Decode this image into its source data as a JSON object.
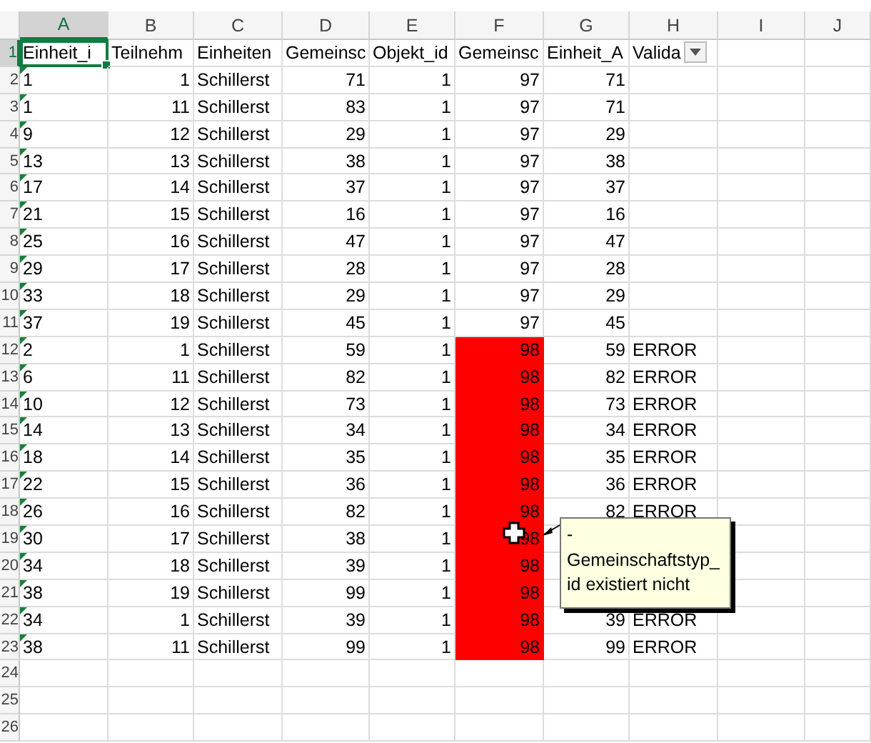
{
  "columns": [
    {
      "letter": "A",
      "selected": true
    },
    {
      "letter": "B",
      "selected": false
    },
    {
      "letter": "C",
      "selected": false
    },
    {
      "letter": "D",
      "selected": false
    },
    {
      "letter": "E",
      "selected": false
    },
    {
      "letter": "F",
      "selected": false
    },
    {
      "letter": "G",
      "selected": false
    },
    {
      "letter": "H",
      "selected": false
    },
    {
      "letter": "I",
      "selected": false
    },
    {
      "letter": "J",
      "selected": false
    }
  ],
  "rows": [
    {
      "row_number": "1",
      "selected": true,
      "cells": [
        {
          "kind": "text",
          "text": "Einheit_i"
        },
        {
          "kind": "text",
          "text": "Teilnehm"
        },
        {
          "kind": "text",
          "text": "Einheiten"
        },
        {
          "kind": "text",
          "text": "Gemeinsc"
        },
        {
          "kind": "text",
          "text": "Objekt_id"
        },
        {
          "kind": "text",
          "text": "Gemeinsc"
        },
        {
          "kind": "text",
          "text": "Einheit_A"
        },
        {
          "kind": "filter_header",
          "text": "Valida"
        }
      ]
    },
    {
      "row_number": "2",
      "selected": false,
      "cells": [
        {
          "kind": "text_number",
          "text": "1"
        },
        {
          "kind": "number",
          "text": "1"
        },
        {
          "kind": "text",
          "text": "Schillerst"
        },
        {
          "kind": "number",
          "text": "71"
        },
        {
          "kind": "number",
          "text": "1"
        },
        {
          "kind": "number",
          "text": "97"
        },
        {
          "kind": "number",
          "text": "71"
        }
      ]
    },
    {
      "row_number": "3",
      "selected": false,
      "cells": [
        {
          "kind": "text_number",
          "text": "1"
        },
        {
          "kind": "number",
          "text": "11"
        },
        {
          "kind": "text",
          "text": "Schillerst"
        },
        {
          "kind": "number",
          "text": "83"
        },
        {
          "kind": "number",
          "text": "1"
        },
        {
          "kind": "number",
          "text": "97"
        },
        {
          "kind": "number",
          "text": "71"
        }
      ]
    },
    {
      "row_number": "4",
      "selected": false,
      "cells": [
        {
          "kind": "text_number",
          "text": "9"
        },
        {
          "kind": "number",
          "text": "12"
        },
        {
          "kind": "text",
          "text": "Schillerst"
        },
        {
          "kind": "number",
          "text": "29"
        },
        {
          "kind": "number",
          "text": "1"
        },
        {
          "kind": "number",
          "text": "97"
        },
        {
          "kind": "number",
          "text": "29"
        }
      ]
    },
    {
      "row_number": "5",
      "selected": false,
      "cells": [
        {
          "kind": "text_number",
          "text": "13"
        },
        {
          "kind": "number",
          "text": "13"
        },
        {
          "kind": "text",
          "text": "Schillerst"
        },
        {
          "kind": "number",
          "text": "38"
        },
        {
          "kind": "number",
          "text": "1"
        },
        {
          "kind": "number",
          "text": "97"
        },
        {
          "kind": "number",
          "text": "38"
        }
      ]
    },
    {
      "row_number": "6",
      "selected": false,
      "cells": [
        {
          "kind": "text_number",
          "text": "17"
        },
        {
          "kind": "number",
          "text": "14"
        },
        {
          "kind": "text",
          "text": "Schillerst"
        },
        {
          "kind": "number",
          "text": "37"
        },
        {
          "kind": "number",
          "text": "1"
        },
        {
          "kind": "number",
          "text": "97"
        },
        {
          "kind": "number",
          "text": "37"
        }
      ]
    },
    {
      "row_number": "7",
      "selected": false,
      "cells": [
        {
          "kind": "text_number",
          "text": "21"
        },
        {
          "kind": "number",
          "text": "15"
        },
        {
          "kind": "text",
          "text": "Schillerst"
        },
        {
          "kind": "number",
          "text": "16"
        },
        {
          "kind": "number",
          "text": "1"
        },
        {
          "kind": "number",
          "text": "97"
        },
        {
          "kind": "number",
          "text": "16"
        }
      ]
    },
    {
      "row_number": "8",
      "selected": false,
      "cells": [
        {
          "kind": "text_number",
          "text": "25"
        },
        {
          "kind": "number",
          "text": "16"
        },
        {
          "kind": "text",
          "text": "Schillerst"
        },
        {
          "kind": "number",
          "text": "47"
        },
        {
          "kind": "number",
          "text": "1"
        },
        {
          "kind": "number",
          "text": "97"
        },
        {
          "kind": "number",
          "text": "47"
        }
      ]
    },
    {
      "row_number": "9",
      "selected": false,
      "cells": [
        {
          "kind": "text_number",
          "text": "29"
        },
        {
          "kind": "number",
          "text": "17"
        },
        {
          "kind": "text",
          "text": "Schillerst"
        },
        {
          "kind": "number",
          "text": "28"
        },
        {
          "kind": "number",
          "text": "1"
        },
        {
          "kind": "number",
          "text": "97"
        },
        {
          "kind": "number",
          "text": "28"
        }
      ]
    },
    {
      "row_number": "10",
      "selected": false,
      "cells": [
        {
          "kind": "text_number",
          "text": "33"
        },
        {
          "kind": "number",
          "text": "18"
        },
        {
          "kind": "text",
          "text": "Schillerst"
        },
        {
          "kind": "number",
          "text": "29"
        },
        {
          "kind": "number",
          "text": "1"
        },
        {
          "kind": "number",
          "text": "97"
        },
        {
          "kind": "number",
          "text": "29"
        }
      ]
    },
    {
      "row_number": "11",
      "selected": false,
      "cells": [
        {
          "kind": "text_number",
          "text": "37"
        },
        {
          "kind": "number",
          "text": "19"
        },
        {
          "kind": "text",
          "text": "Schillerst"
        },
        {
          "kind": "number",
          "text": "45"
        },
        {
          "kind": "number",
          "text": "1"
        },
        {
          "kind": "number",
          "text": "97"
        },
        {
          "kind": "number",
          "text": "45"
        }
      ]
    },
    {
      "row_number": "12",
      "selected": false,
      "cells": [
        {
          "kind": "text_number",
          "text": "2"
        },
        {
          "kind": "number",
          "text": "1"
        },
        {
          "kind": "text",
          "text": "Schillerst"
        },
        {
          "kind": "number",
          "text": "59"
        },
        {
          "kind": "number",
          "text": "1"
        },
        {
          "kind": "flagged_number",
          "text": "98"
        },
        {
          "kind": "number",
          "text": "59"
        },
        {
          "kind": "text",
          "text": "ERROR"
        }
      ]
    },
    {
      "row_number": "13",
      "selected": false,
      "cells": [
        {
          "kind": "text_number",
          "text": "6"
        },
        {
          "kind": "number",
          "text": "11"
        },
        {
          "kind": "text",
          "text": "Schillerst"
        },
        {
          "kind": "number",
          "text": "82"
        },
        {
          "kind": "number",
          "text": "1"
        },
        {
          "kind": "flagged_number",
          "text": "98"
        },
        {
          "kind": "number",
          "text": "82"
        },
        {
          "kind": "text",
          "text": "ERROR"
        }
      ]
    },
    {
      "row_number": "14",
      "selected": false,
      "cells": [
        {
          "kind": "text_number",
          "text": "10"
        },
        {
          "kind": "number",
          "text": "12"
        },
        {
          "kind": "text",
          "text": "Schillerst"
        },
        {
          "kind": "number",
          "text": "73"
        },
        {
          "kind": "number",
          "text": "1"
        },
        {
          "kind": "flagged_number",
          "text": "98"
        },
        {
          "kind": "number",
          "text": "73"
        },
        {
          "kind": "text",
          "text": "ERROR"
        }
      ]
    },
    {
      "row_number": "15",
      "selected": false,
      "cells": [
        {
          "kind": "text_number",
          "text": "14"
        },
        {
          "kind": "number",
          "text": "13"
        },
        {
          "kind": "text",
          "text": "Schillerst"
        },
        {
          "kind": "number",
          "text": "34"
        },
        {
          "kind": "number",
          "text": "1"
        },
        {
          "kind": "flagged_number",
          "text": "98"
        },
        {
          "kind": "number",
          "text": "34"
        },
        {
          "kind": "text",
          "text": "ERROR"
        }
      ]
    },
    {
      "row_number": "16",
      "selected": false,
      "cells": [
        {
          "kind": "text_number",
          "text": "18"
        },
        {
          "kind": "number",
          "text": "14"
        },
        {
          "kind": "text",
          "text": "Schillerst"
        },
        {
          "kind": "number",
          "text": "35"
        },
        {
          "kind": "number",
          "text": "1"
        },
        {
          "kind": "flagged_number",
          "text": "98"
        },
        {
          "kind": "number",
          "text": "35"
        },
        {
          "kind": "text",
          "text": "ERROR"
        }
      ]
    },
    {
      "row_number": "17",
      "selected": false,
      "cells": [
        {
          "kind": "text_number",
          "text": "22"
        },
        {
          "kind": "number",
          "text": "15"
        },
        {
          "kind": "text",
          "text": "Schillerst"
        },
        {
          "kind": "number",
          "text": "36"
        },
        {
          "kind": "number",
          "text": "1"
        },
        {
          "kind": "flagged_number",
          "text": "98"
        },
        {
          "kind": "number",
          "text": "36"
        },
        {
          "kind": "text",
          "text": "ERROR"
        }
      ]
    },
    {
      "row_number": "18",
      "selected": false,
      "cells": [
        {
          "kind": "text_number",
          "text": "26"
        },
        {
          "kind": "number",
          "text": "16"
        },
        {
          "kind": "text",
          "text": "Schillerst"
        },
        {
          "kind": "number",
          "text": "82"
        },
        {
          "kind": "number",
          "text": "1"
        },
        {
          "kind": "flagged_number",
          "text": "98"
        },
        {
          "kind": "number",
          "text": "82"
        },
        {
          "kind": "text",
          "text": "ERROR"
        }
      ]
    },
    {
      "row_number": "19",
      "selected": false,
      "cells": [
        {
          "kind": "text_number",
          "text": "30"
        },
        {
          "kind": "number",
          "text": "17"
        },
        {
          "kind": "text",
          "text": "Schillerst"
        },
        {
          "kind": "number",
          "text": "38"
        },
        {
          "kind": "number",
          "text": "1"
        },
        {
          "kind": "flagged_number",
          "text": "98"
        }
      ]
    },
    {
      "row_number": "20",
      "selected": false,
      "cells": [
        {
          "kind": "text_number",
          "text": "34"
        },
        {
          "kind": "number",
          "text": "18"
        },
        {
          "kind": "text",
          "text": "Schillerst"
        },
        {
          "kind": "number",
          "text": "39"
        },
        {
          "kind": "number",
          "text": "1"
        },
        {
          "kind": "flagged_number",
          "text": "98"
        }
      ]
    },
    {
      "row_number": "21",
      "selected": false,
      "cells": [
        {
          "kind": "text_number",
          "text": "38"
        },
        {
          "kind": "number",
          "text": "19"
        },
        {
          "kind": "text",
          "text": "Schillerst"
        },
        {
          "kind": "number",
          "text": "99"
        },
        {
          "kind": "number",
          "text": "1"
        },
        {
          "kind": "flagged_number",
          "text": "98"
        }
      ]
    },
    {
      "row_number": "22",
      "selected": false,
      "cells": [
        {
          "kind": "text_number",
          "text": "34"
        },
        {
          "kind": "number",
          "text": "1"
        },
        {
          "kind": "text",
          "text": "Schillerst"
        },
        {
          "kind": "number",
          "text": "39"
        },
        {
          "kind": "number",
          "text": "1"
        },
        {
          "kind": "flagged_number",
          "text": "98"
        },
        {
          "kind": "number",
          "text": "39"
        },
        {
          "kind": "text",
          "text": "ERROR"
        }
      ]
    },
    {
      "row_number": "23",
      "selected": false,
      "cells": [
        {
          "kind": "text_number",
          "text": "38"
        },
        {
          "kind": "number",
          "text": "11"
        },
        {
          "kind": "text",
          "text": "Schillerst"
        },
        {
          "kind": "number",
          "text": "99"
        },
        {
          "kind": "number",
          "text": "1"
        },
        {
          "kind": "flagged_number",
          "text": "98"
        },
        {
          "kind": "number",
          "text": "99"
        },
        {
          "kind": "text",
          "text": "ERROR"
        }
      ]
    },
    {
      "row_number": "24",
      "selected": false,
      "cells": []
    },
    {
      "row_number": "25",
      "selected": false,
      "cells": []
    },
    {
      "row_number": "26",
      "selected": false,
      "cells": []
    }
  ],
  "comment": {
    "text": "-\nGemeinschaftstyp_\nid existiert nicht"
  }
}
